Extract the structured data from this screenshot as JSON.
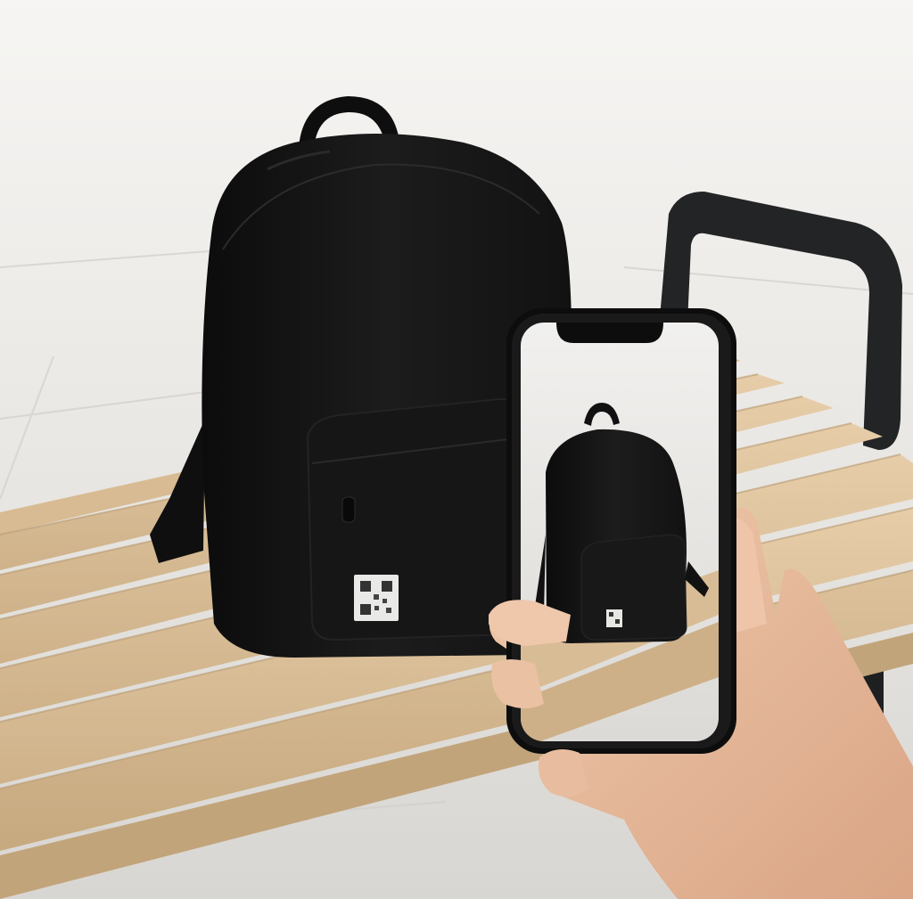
{
  "scene": {
    "description_visible_text": [],
    "subjects": {
      "backpack": {
        "color": "#131313",
        "tag": "qr-code-tag"
      },
      "bench": {
        "slat_color": "#d9bd96",
        "frame_color": "#202122"
      },
      "smartphone": {
        "frame_color": "#0e0e0e",
        "screen_content": "backpack-on-bench"
      },
      "hand": {
        "skin_color": "#e9bfa3"
      }
    },
    "colors": {
      "background_top": "#f3f2ef",
      "background_floor": "#d9d7d3",
      "pavement_lines": "#cfccc7"
    }
  }
}
